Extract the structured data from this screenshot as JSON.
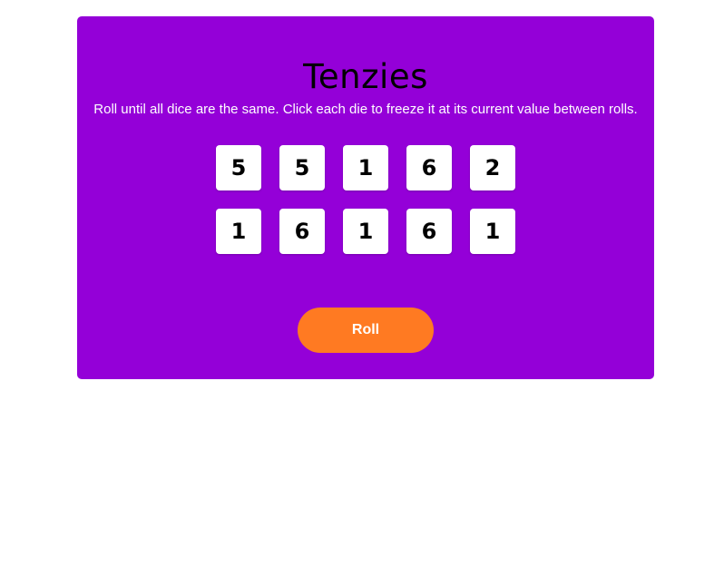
{
  "game": {
    "title": "Tenzies",
    "instructions": "Roll until all dice are the same. Click each die to freeze it at its current value between rolls.",
    "dice": [
      "5",
      "5",
      "1",
      "6",
      "2",
      "1",
      "6",
      "1",
      "6",
      "1"
    ],
    "roll_label": "Roll"
  },
  "colors": {
    "card_background": "#9400d8",
    "die_background": "#ffffff",
    "roll_button": "#ff7a22"
  }
}
